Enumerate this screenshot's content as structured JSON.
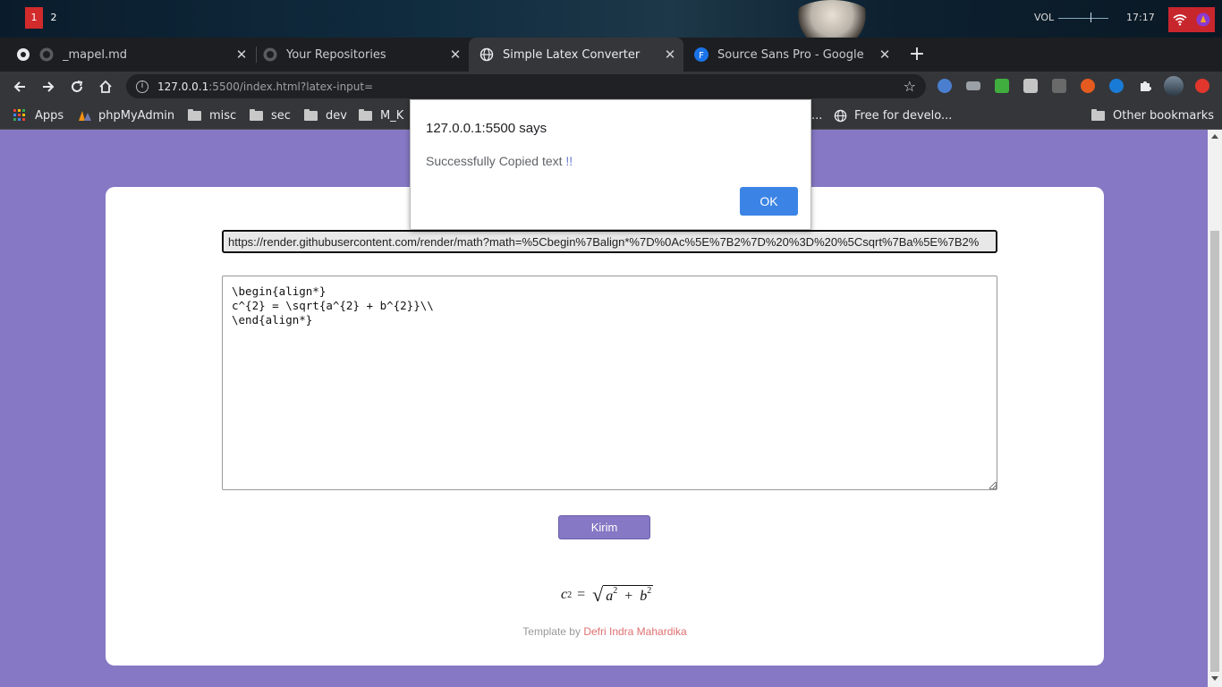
{
  "desktop": {
    "workspaces": [
      "1",
      "2"
    ],
    "volume_label": "VOL",
    "volume_level": 0.65,
    "clock": "17:17"
  },
  "browser": {
    "tabs": [
      {
        "title": "_mapel.md",
        "icon": "github-icon"
      },
      {
        "title": "Your Repositories",
        "icon": "github-icon"
      },
      {
        "title": "Simple Latex Converter",
        "icon": "globe-icon",
        "active": true
      },
      {
        "title": "Source Sans Pro - Google",
        "icon": "google-fonts-icon"
      }
    ],
    "address": {
      "host": "127.0.0.1",
      "rest": ":5500/index.html?latex-input="
    },
    "bookmarks": {
      "apps": "Apps",
      "phpmyadmin": "phpMyAdmin",
      "misc": "misc",
      "sec": "sec",
      "dev": "dev",
      "mk": "M_K",
      "trunc": "...",
      "free": "Free for develo...",
      "other": "Other bookmarks"
    }
  },
  "page": {
    "url_output": "https://render.githubusercontent.com/render/math?math=%5Cbegin%7Balign*%7D%0Ac%5E%7B2%7D%20%3D%20%5Csqrt%7Ba%5E%7B2%",
    "latex_input": "\\begin{align*}\nc^{2} = \\sqrt{a^{2} + b^{2}}\\\\\n\\end{align*}",
    "submit_label": "Kirim",
    "math_preview": {
      "lhs": "c",
      "exp": "2",
      "a": "a",
      "b": "b",
      "plus": "+",
      "eq": "="
    },
    "footer_prefix": "Template by ",
    "footer_author": "Defri Indra Mahardika"
  },
  "dialog": {
    "title": "127.0.0.1:5500  says",
    "message": "Successfully Copied text ",
    "message_emph": "!!",
    "ok_label": "OK"
  },
  "colors": {
    "page_bg": "#8678c4",
    "dialog_ok": "#3b84e5",
    "workspace_active": "#d22b2b"
  }
}
